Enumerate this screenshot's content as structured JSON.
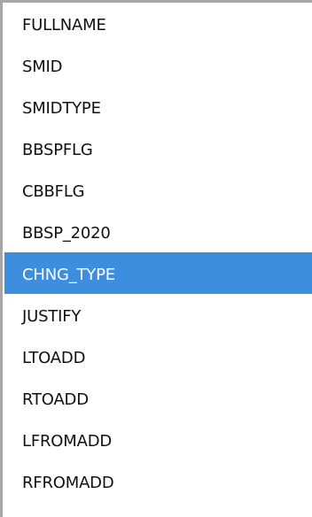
{
  "list": {
    "items": [
      {
        "label": "FULLNAME"
      },
      {
        "label": "SMID"
      },
      {
        "label": "SMIDTYPE"
      },
      {
        "label": "BBSPFLG"
      },
      {
        "label": "CBBFLG"
      },
      {
        "label": "BBSP_2020"
      },
      {
        "label": "CHNG_TYPE"
      },
      {
        "label": "JUSTIFY"
      },
      {
        "label": "LTOADD"
      },
      {
        "label": "RTOADD"
      },
      {
        "label": "LFROMADD"
      },
      {
        "label": "RFROMADD"
      }
    ],
    "selected_label": "CHNG_TYPE"
  },
  "colors": {
    "selection": "#3e8ee0",
    "border": "#a6a6a6",
    "text": "#111111",
    "selected_text": "#ffffff"
  }
}
